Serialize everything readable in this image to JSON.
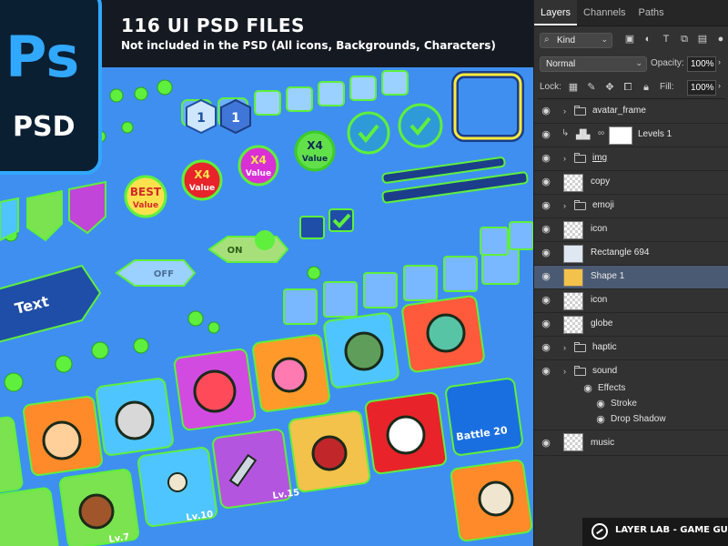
{
  "canvas": {
    "headline": "116 UI PSD FILES",
    "subline": "Not included in the PSD (All icons, Backgrounds, Characters)",
    "logo": {
      "ps": "Ps",
      "psd": "PSD"
    },
    "background_color": "#3f8ff0",
    "accent_green": "#5ef03c",
    "art_labels": {
      "badge_best": "BEST",
      "badge_best_value": "Value",
      "badge_x4_red": "X4",
      "badge_x4_red_value": "Value",
      "badge_x4_pink": "X4",
      "badge_x4_pink_value": "Value",
      "badge_x4_green": "X4",
      "badge_x4_green_value": "Value",
      "toggle_off": "OFF",
      "toggle_on": "ON",
      "text_banner": "Text",
      "level_a": "1",
      "level_b": "1",
      "lv_10": "Lv.10",
      "lv_15": "Lv.15",
      "lv_7": "Lv.7",
      "battle": "Battle 20"
    }
  },
  "panel": {
    "tabs": [
      {
        "label": "Layers",
        "active": true
      },
      {
        "label": "Channels",
        "active": false
      },
      {
        "label": "Paths",
        "active": false
      }
    ],
    "filter": {
      "kind_label": "Kind"
    },
    "blend": {
      "mode": "Normal",
      "opacity_label": "Opacity:",
      "opacity_value": "100%"
    },
    "lock": {
      "lock_label": "Lock:",
      "fill_label": "Fill:",
      "fill_value": "100%"
    },
    "layers": [
      {
        "name": "avatar_frame",
        "type": "folder"
      },
      {
        "name": "Levels 1",
        "type": "adjustment"
      },
      {
        "name": "img",
        "type": "folder"
      },
      {
        "name": "copy",
        "type": "layer"
      },
      {
        "name": "emoji",
        "type": "folder"
      },
      {
        "name": "icon",
        "type": "layer"
      },
      {
        "name": "Rectangle 694",
        "type": "layer"
      },
      {
        "name": "Shape 1",
        "type": "layer",
        "selected": true
      },
      {
        "name": "icon",
        "type": "layer"
      },
      {
        "name": "globe",
        "type": "layer"
      },
      {
        "name": "haptic",
        "type": "folder"
      },
      {
        "name": "sound",
        "type": "folder"
      },
      {
        "name": "Effects",
        "type": "effects"
      },
      {
        "name": "Stroke",
        "type": "effect"
      },
      {
        "name": "Drop Shadow",
        "type": "effect"
      },
      {
        "name": "music",
        "type": "layer"
      }
    ]
  },
  "footer": {
    "text": "LAYER LAB - GAME GUI"
  }
}
